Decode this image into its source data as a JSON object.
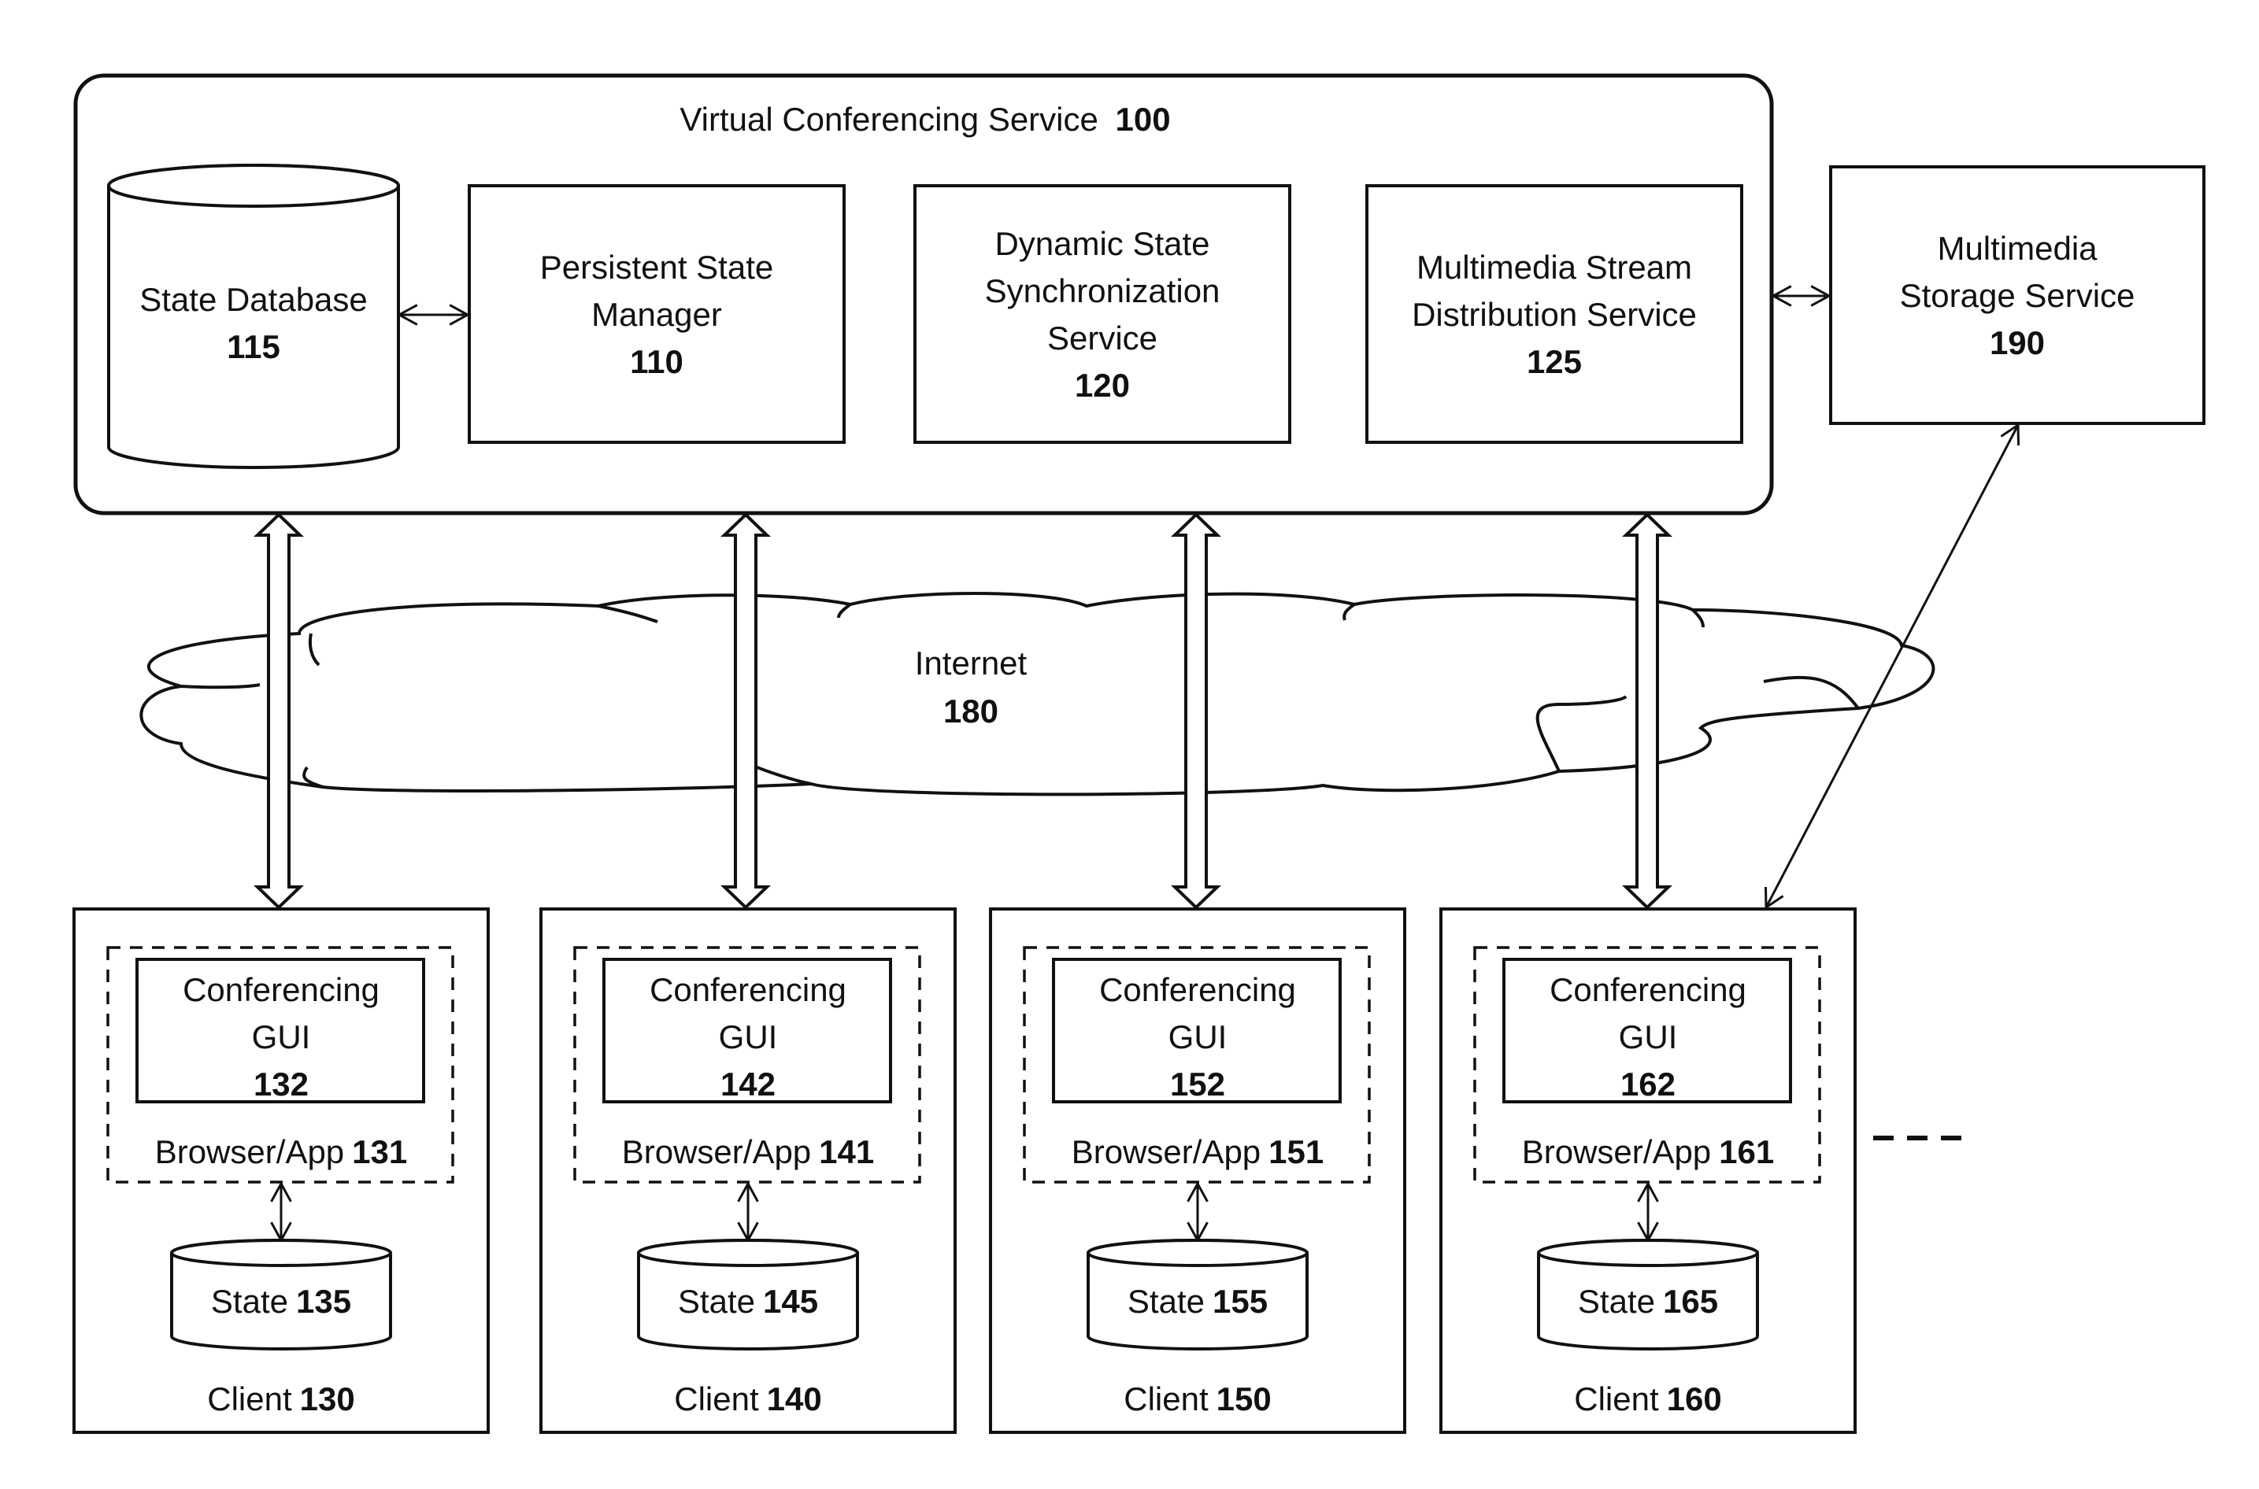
{
  "diagram": {
    "service": {
      "id": "100",
      "label": "Virtual Conferencing Service",
      "components": [
        {
          "key": "state-database",
          "kind": "database",
          "lines": [
            "State Database"
          ],
          "number": "115"
        },
        {
          "key": "persistent-state-manager",
          "kind": "box",
          "lines": [
            "Persistent State",
            "Manager"
          ],
          "number": "110"
        },
        {
          "key": "dynamic-state-sync-service",
          "kind": "box",
          "lines": [
            "Dynamic State",
            "Synchronization",
            "Service"
          ],
          "number": "120"
        },
        {
          "key": "multimedia-stream-distribution-service",
          "kind": "box",
          "lines": [
            "Multimedia Stream",
            "Distribution Service"
          ],
          "number": "125"
        }
      ]
    },
    "storage": {
      "lines": [
        "Multimedia",
        "Storage Service"
      ],
      "number": "190"
    },
    "internet": {
      "label": "Internet",
      "number": "180"
    },
    "clients": [
      {
        "client_label": "Client",
        "client_number": "130",
        "gui_lines": [
          "Conferencing",
          "GUI"
        ],
        "gui_number": "132",
        "app_label": "Browser/App",
        "app_number": "131",
        "state_label": "State",
        "state_number": "135"
      },
      {
        "client_label": "Client",
        "client_number": "140",
        "gui_lines": [
          "Conferencing",
          "GUI"
        ],
        "gui_number": "142",
        "app_label": "Browser/App",
        "app_number": "141",
        "state_label": "State",
        "state_number": "145"
      },
      {
        "client_label": "Client",
        "client_number": "150",
        "gui_lines": [
          "Conferencing",
          "GUI"
        ],
        "gui_number": "152",
        "app_label": "Browser/App",
        "app_number": "151",
        "state_label": "State",
        "state_number": "155"
      },
      {
        "client_label": "Client",
        "client_number": "160",
        "gui_lines": [
          "Conferencing",
          "GUI"
        ],
        "gui_number": "162",
        "app_label": "Browser/App",
        "app_number": "161",
        "state_label": "State",
        "state_number": "165"
      }
    ],
    "more_clients_indicator": "ellipsis-dashes",
    "connections": [
      {
        "from": "State Database 115",
        "to": "Persistent State Manager 110",
        "type": "bidirectional-thin"
      },
      {
        "from": "Multimedia Stream Distribution Service 125",
        "to": "Multimedia Storage Service 190",
        "type": "bidirectional-thin"
      },
      {
        "from": "Virtual Conferencing Service 100",
        "to": "Client 130",
        "type": "bidirectional-hollow",
        "via": "Internet 180"
      },
      {
        "from": "Virtual Conferencing Service 100",
        "to": "Client 140",
        "type": "bidirectional-hollow",
        "via": "Internet 180"
      },
      {
        "from": "Virtual Conferencing Service 100",
        "to": "Client 150",
        "type": "bidirectional-hollow",
        "via": "Internet 180"
      },
      {
        "from": "Virtual Conferencing Service 100",
        "to": "Client 160",
        "type": "bidirectional-hollow",
        "via": "Internet 180"
      },
      {
        "from": "Multimedia Storage Service 190",
        "to": "Client 160",
        "type": "bidirectional-thin"
      },
      {
        "from": "Browser/App",
        "to": "State",
        "type": "bidirectional-thin",
        "scope": "each client"
      }
    ]
  }
}
